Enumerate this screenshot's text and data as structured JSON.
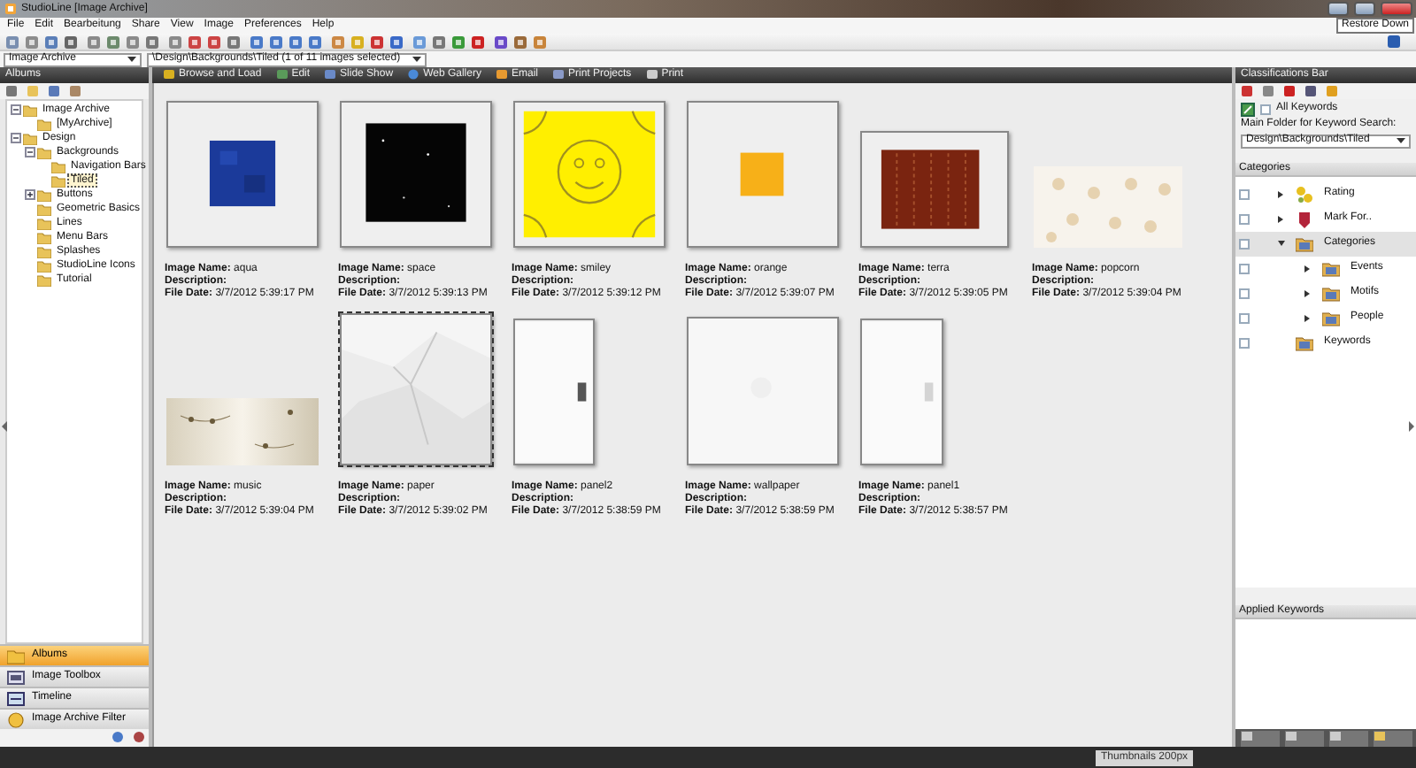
{
  "window": {
    "title": "StudioLine [Image Archive]",
    "tooltip": "Restore Down"
  },
  "menu": [
    "File",
    "Edit",
    "Bearbeitung",
    "Share",
    "View",
    "Image",
    "Preferences",
    "Help"
  ],
  "address": {
    "archive": "Image Archive",
    "path": "\\Design\\Backgrounds\\Tiled (1 of 11 images selected)"
  },
  "albums_panel": {
    "title": "Albums",
    "tree": [
      {
        "label": "Image Archive",
        "selected": false,
        "expanded": true,
        "children": [
          {
            "label": "[MyArchive]",
            "selected": false
          }
        ]
      },
      {
        "label": "Design",
        "selected": false,
        "expanded": true,
        "children": [
          {
            "label": "Backgrounds",
            "selected": false,
            "expanded": true,
            "children": [
              {
                "label": "Navigation Bars",
                "selected": false
              },
              {
                "label": "Tiled",
                "selected": true
              }
            ]
          },
          {
            "label": "Buttons",
            "selected": false,
            "expanded": false
          },
          {
            "label": "Geometric Basics",
            "selected": false
          },
          {
            "label": "Lines",
            "selected": false
          },
          {
            "label": "Menu Bars",
            "selected": false
          },
          {
            "label": "Splashes",
            "selected": false
          },
          {
            "label": "StudioLine Icons",
            "selected": false
          },
          {
            "label": "Tutorial",
            "selected": false
          }
        ]
      }
    ],
    "nav": [
      {
        "label": "Albums",
        "selected": true,
        "kind": "folder"
      },
      {
        "label": "Image Toolbox",
        "selected": false,
        "kind": "toolbox"
      },
      {
        "label": "Timeline",
        "selected": false,
        "kind": "timeline"
      },
      {
        "label": "Image Archive Filter",
        "selected": false,
        "kind": "filter"
      }
    ]
  },
  "actions": [
    {
      "label": "Browse and Load",
      "kind": "browse"
    },
    {
      "label": "Edit",
      "kind": "edit"
    },
    {
      "label": "Slide Show",
      "kind": "slides"
    },
    {
      "label": "Web Gallery",
      "kind": "web"
    },
    {
      "label": "Email",
      "kind": "email"
    },
    {
      "label": "Print Projects",
      "kind": "projects"
    },
    {
      "label": "Print",
      "kind": "print"
    }
  ],
  "images": [
    {
      "kind": "aqua",
      "selected": false,
      "name_label": "Image Name:",
      "name": "aqua",
      "description_label": "Description:",
      "date_label": "File Date:",
      "date": "3/7/2012 5:39:17 PM"
    },
    {
      "kind": "space",
      "selected": false,
      "name_label": "Image Name:",
      "name": "space",
      "description_label": "Description:",
      "date_label": "File Date:",
      "date": "3/7/2012 5:39:13 PM"
    },
    {
      "kind": "smiley",
      "selected": false,
      "name_label": "Image Name:",
      "name": "smiley",
      "description_label": "Description:",
      "date_label": "File Date:",
      "date": "3/7/2012 5:39:12 PM"
    },
    {
      "kind": "orange",
      "selected": false,
      "name_label": "Image Name:",
      "name": "orange",
      "description_label": "Description:",
      "date_label": "File Date:",
      "date": "3/7/2012 5:39:07 PM"
    },
    {
      "kind": "terra",
      "selected": false,
      "name_label": "Image Name:",
      "name": "terra",
      "description_label": "Description:",
      "date_label": "File Date:",
      "date": "3/7/2012 5:39:05 PM"
    },
    {
      "kind": "popcorn",
      "selected": false,
      "name_label": "Image Name:",
      "name": "popcorn",
      "description_label": "Description:",
      "date_label": "File Date:",
      "date": "3/7/2012 5:39:04 PM"
    },
    {
      "kind": "music",
      "selected": false,
      "name_label": "Image Name:",
      "name": "music",
      "description_label": "Description:",
      "date_label": "File Date:",
      "date": "3/7/2012 5:39:04 PM"
    },
    {
      "kind": "paper",
      "selected": true,
      "name_label": "Image Name:",
      "name": "paper",
      "description_label": "Description:",
      "date_label": "File Date:",
      "date": "3/7/2012 5:39:02 PM"
    },
    {
      "kind": "panel-dark",
      "selected": false,
      "name_label": "Image Name:",
      "name": "panel2",
      "description_label": "Description:",
      "date_label": "File Date:",
      "date": "3/7/2012 5:38:59 PM"
    },
    {
      "kind": "wallpaper",
      "selected": false,
      "name_label": "Image Name:",
      "name": "wallpaper",
      "description_label": "Description:",
      "date_label": "File Date:",
      "date": "3/7/2012 5:38:59 PM"
    },
    {
      "kind": "panel-light",
      "selected": false,
      "name_label": "Image Name:",
      "name": "panel1",
      "description_label": "Description:",
      "date_label": "File Date:",
      "date": "3/7/2012 5:38:57 PM"
    }
  ],
  "status_bar": {
    "thumbnail_size": "Thumbnails 200px"
  },
  "classifications": {
    "title": "Classifications Bar",
    "all_keywords": {
      "label": "All Keywords",
      "checked": false
    },
    "folder_label": "Main Folder for Keyword Search:",
    "folder": "Design\\Backgrounds\\Tiled",
    "categories_title": "Categories",
    "tree": [
      {
        "label": "Rating",
        "kind": "rating",
        "checked": false,
        "selected": false,
        "expanded": false
      },
      {
        "label": "Mark For..",
        "kind": "mark",
        "checked": false,
        "selected": false,
        "expanded": false
      },
      {
        "label": "Categories",
        "kind": "folder",
        "checked": false,
        "selected": true,
        "expanded": true,
        "children": [
          {
            "label": "Events",
            "kind": "folder",
            "checked": false,
            "selected": false,
            "expanded": false
          },
          {
            "label": "Motifs",
            "kind": "folder",
            "checked": false,
            "selected": false,
            "expanded": false
          },
          {
            "label": "People",
            "kind": "folder",
            "checked": false,
            "selected": false,
            "expanded": false
          }
        ]
      },
      {
        "label": "Keywords",
        "kind": "folder",
        "checked": false,
        "selected": false
      }
    ],
    "applied_title": "Applied Keywords"
  }
}
